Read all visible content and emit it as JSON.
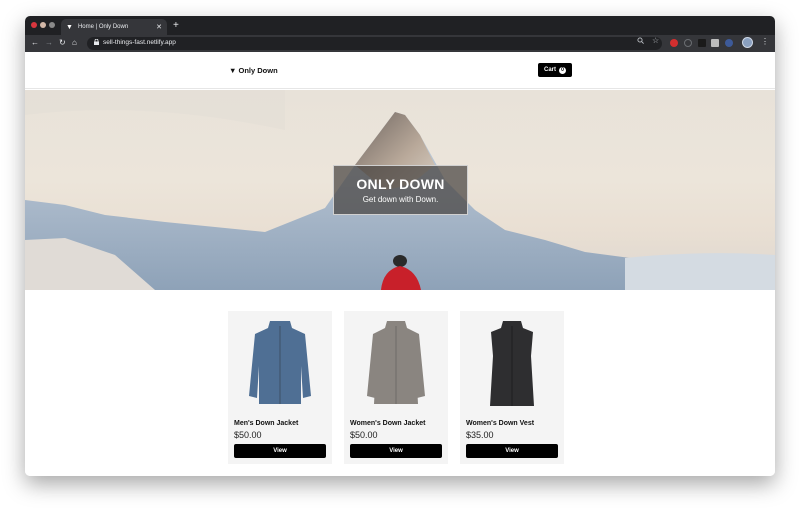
{
  "browser": {
    "tab_title": "Home | Only Down",
    "tab_favicon": "▼",
    "new_tab_label": "+",
    "url": "sell-things-fast.netlify.app",
    "icons": {
      "back": "←",
      "forward": "→",
      "reload": "↻",
      "home": "⌂",
      "lock": "🔒",
      "search": "⚲",
      "star": "☆",
      "close": "✕",
      "menu": "⋮"
    }
  },
  "site": {
    "logo": "▼ Only Down",
    "cart_label": "Cart",
    "cart_count": "0"
  },
  "hero": {
    "title": "ONLY DOWN",
    "subtitle": "Get down with Down."
  },
  "products": [
    {
      "name": "Men's Down Jacket",
      "price": "$50.00",
      "button": "View",
      "color": "#4f6f94"
    },
    {
      "name": "Women's Down Jacket",
      "price": "$50.00",
      "button": "View",
      "color": "#8a8580"
    },
    {
      "name": "Women's Down Vest",
      "price": "$35.00",
      "button": "View",
      "color": "#2e2e30"
    }
  ]
}
